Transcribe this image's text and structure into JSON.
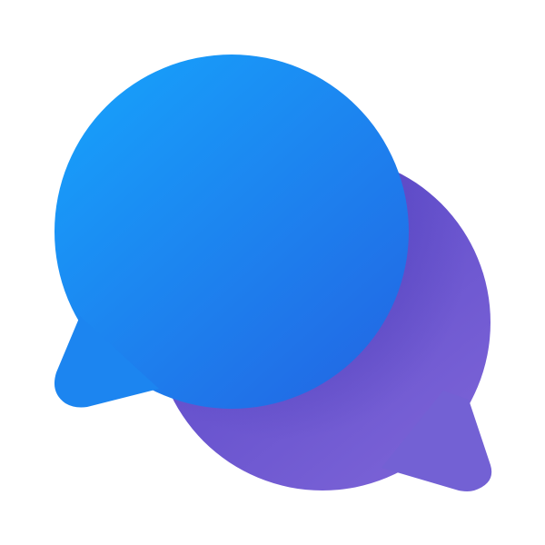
{
  "logo": {
    "icon": "chat-bubbles-icon",
    "colors": {
      "front_bubble_light": "#17a0fb",
      "front_bubble_dark": "#2268e4",
      "back_bubble_light": "#7a62d6",
      "back_bubble_dark": "#4d3fc0",
      "background": "#ffffff"
    }
  }
}
